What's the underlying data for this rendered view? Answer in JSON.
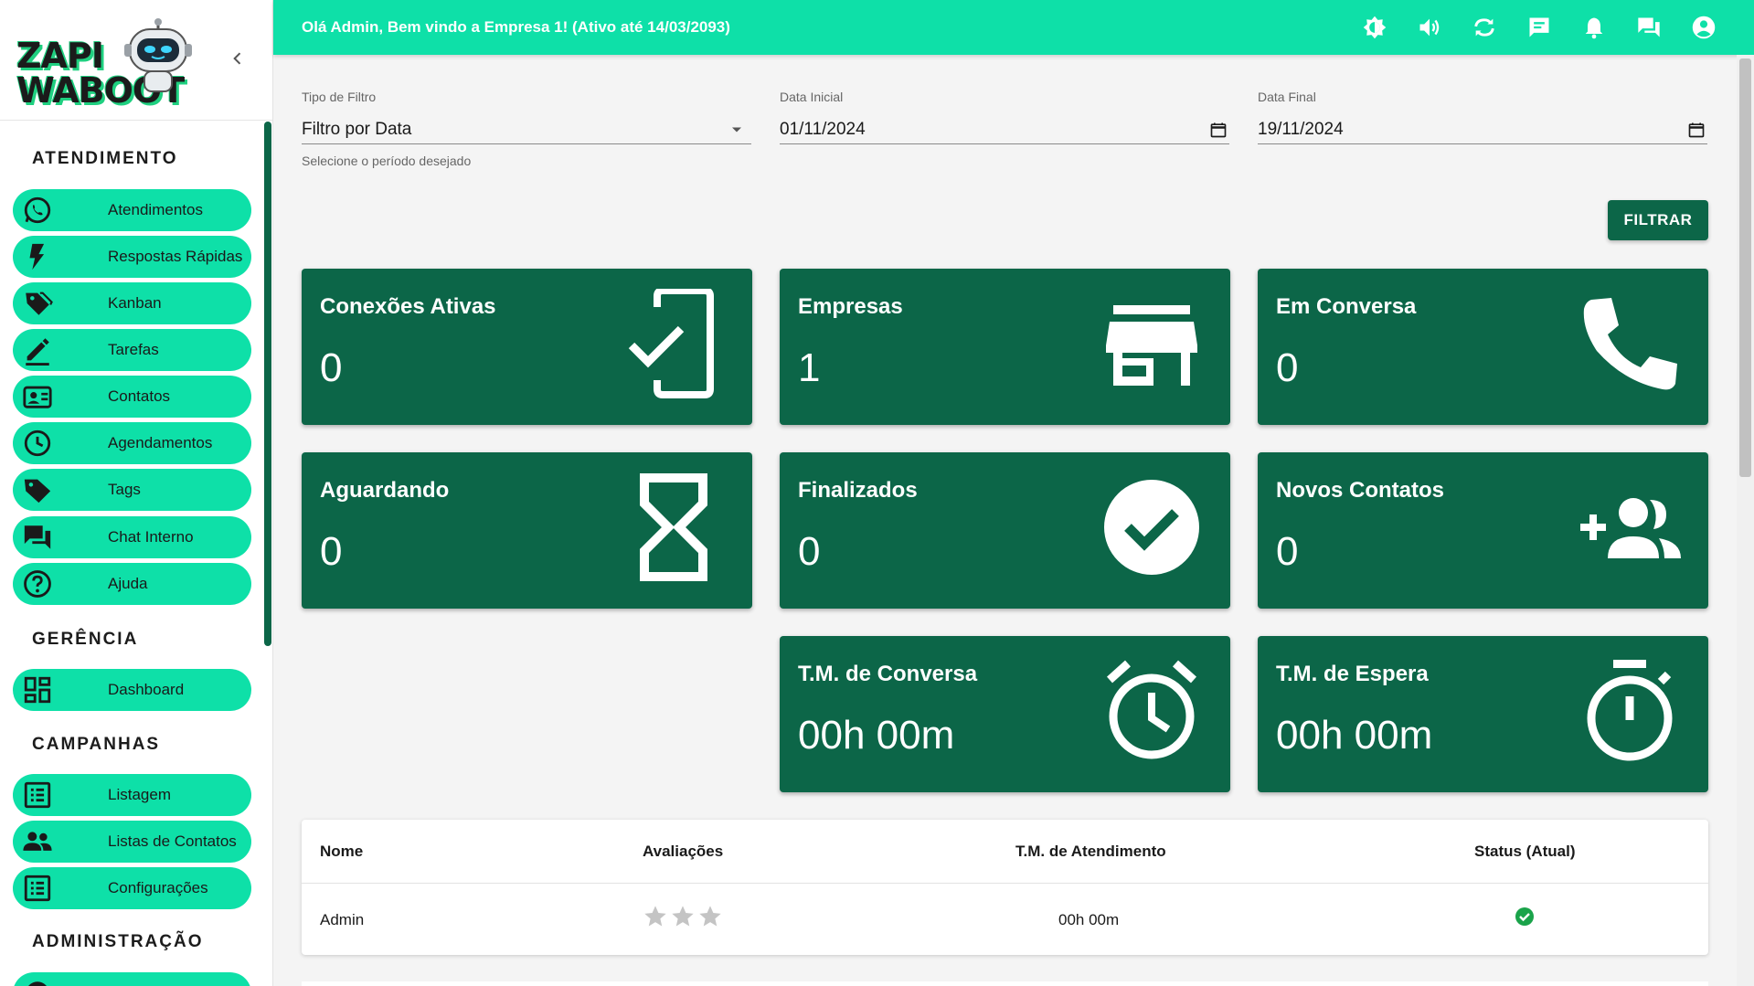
{
  "sidebar": {
    "logo_line1": "ZAPI",
    "logo_line2": "WABOOT",
    "sections": {
      "atendimento": "ATENDIMENTO",
      "gerencia": "GERÊNCIA",
      "campanhas": "CAMPANHAS",
      "administracao": "ADMINISTRAÇÃO"
    },
    "items": {
      "atendimentos": "Atendimentos",
      "respostas": "Respostas Rápidas",
      "kanban": "Kanban",
      "tarefas": "Tarefas",
      "contatos": "Contatos",
      "agendamentos": "Agendamentos",
      "tags": "Tags",
      "chat_interno": "Chat Interno",
      "ajuda": "Ajuda",
      "dashboard": "Dashboard",
      "listagem": "Listagem",
      "listas_contatos": "Listas de Contatos",
      "configuracoes": "Configurações"
    }
  },
  "topbar": {
    "welcome": "Olá Admin, Bem vindo a Empresa 1! (Ativo até 14/03/2093)"
  },
  "filters": {
    "tipo_label": "Tipo de Filtro",
    "tipo_value": "Filtro por Data",
    "tipo_helper": "Selecione o período desejado",
    "inicial_label": "Data Inicial",
    "inicial_value": "01/11/2024",
    "final_label": "Data Final",
    "final_value": "19/11/2024",
    "button": "FILTRAR"
  },
  "cards": {
    "conexoes": {
      "title": "Conexões Ativas",
      "value": "0"
    },
    "empresas": {
      "title": "Empresas",
      "value": "1"
    },
    "em_conversa": {
      "title": "Em Conversa",
      "value": "0"
    },
    "aguardando": {
      "title": "Aguardando",
      "value": "0"
    },
    "finalizados": {
      "title": "Finalizados",
      "value": "0"
    },
    "novos_contatos": {
      "title": "Novos Contatos",
      "value": "0"
    },
    "tm_conversa": {
      "title": "T.M. de Conversa",
      "value": "00h 00m"
    },
    "tm_espera": {
      "title": "T.M. de Espera",
      "value": "00h 00m"
    }
  },
  "table": {
    "headers": {
      "nome": "Nome",
      "avaliacoes": "Avaliações",
      "tm": "T.M. de Atendimento",
      "status": "Status (Atual)"
    },
    "rows": [
      {
        "nome": "Admin",
        "tm": "00h 00m",
        "stars": 0,
        "status": "online"
      }
    ]
  },
  "colors": {
    "accent": "#0ee0a8",
    "card": "#0c6648",
    "status_ok": "#1aa34a"
  }
}
